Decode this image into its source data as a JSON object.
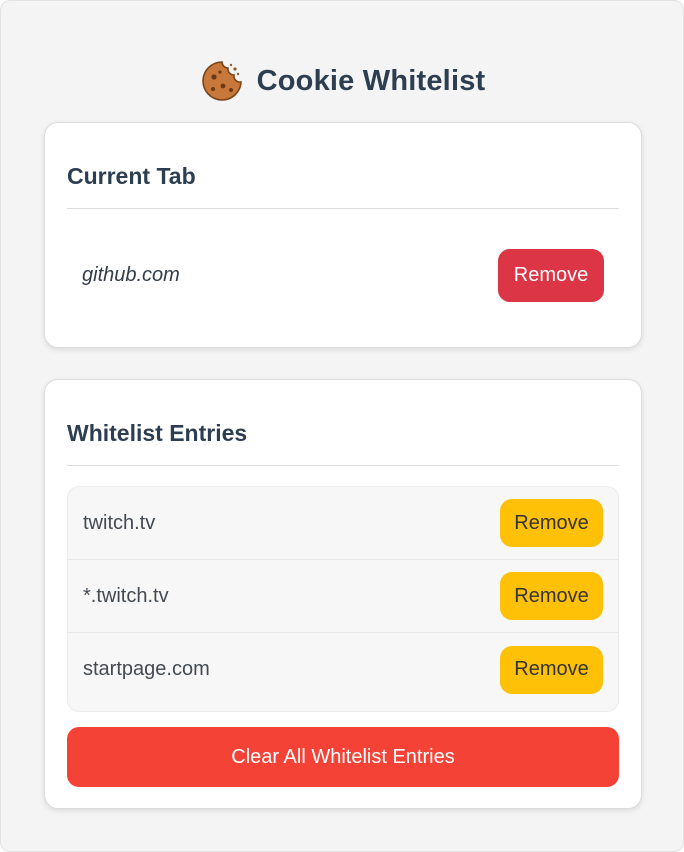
{
  "app": {
    "title": "Cookie Whitelist",
    "icon": "cookie-icon"
  },
  "current_tab": {
    "heading": "Current Tab",
    "domain": "github.com",
    "remove_label": "Remove"
  },
  "whitelist": {
    "heading": "Whitelist Entries",
    "entries": [
      {
        "domain": "twitch.tv",
        "remove_label": "Remove"
      },
      {
        "domain": "*.twitch.tv",
        "remove_label": "Remove"
      },
      {
        "domain": "startpage.com",
        "remove_label": "Remove"
      }
    ],
    "clear_all_label": "Clear All Whitelist Entries"
  },
  "colors": {
    "title": "#2c3e50",
    "danger": "#dc3545",
    "warning": "#ffc107",
    "clear_all": "#f44336",
    "background": "#f4f4f4"
  }
}
